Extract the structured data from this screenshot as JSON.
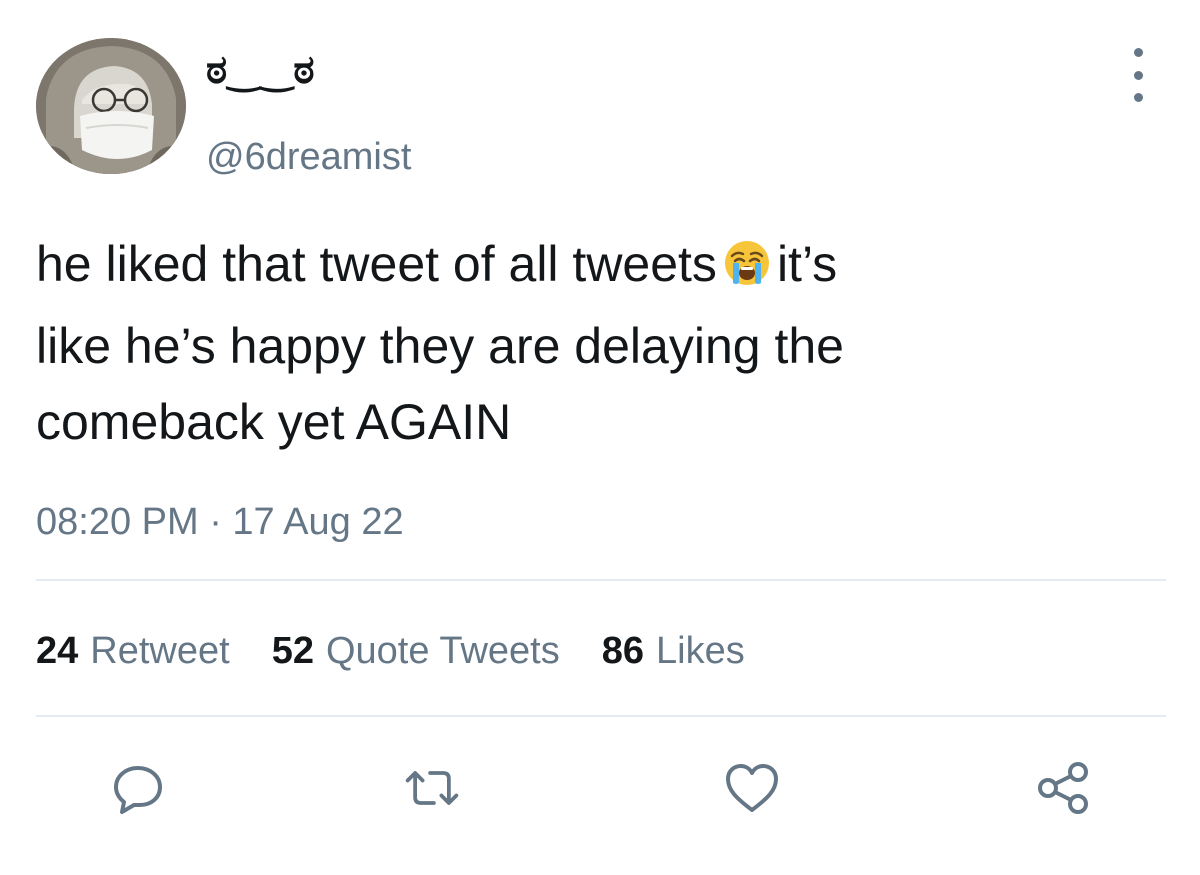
{
  "user": {
    "display_name": "ಠ‿‿ಠ",
    "handle": "@6dreamist"
  },
  "tweet": {
    "line1_a": "he liked that tweet of all tweets",
    "line1_emoji": "loudly-crying-face-emoji",
    "line1_b": "it’s",
    "line2": "like he’s happy they are delaying the",
    "line3": "comeback yet AGAIN",
    "timestamp": "08:20 PM · 17 Aug 22"
  },
  "stats": {
    "retweets": {
      "count": "24",
      "label": "Retweet"
    },
    "quotes": {
      "count": "52",
      "label": "Quote Tweets"
    },
    "likes": {
      "count": "86",
      "label": "Likes"
    }
  },
  "actions": [
    "reply-icon",
    "retweet-icon",
    "like-icon",
    "share-icon"
  ],
  "colors": {
    "text": "#14171a",
    "secondary": "#657786",
    "divider": "#e6ecf0",
    "background": "#ffffff"
  }
}
